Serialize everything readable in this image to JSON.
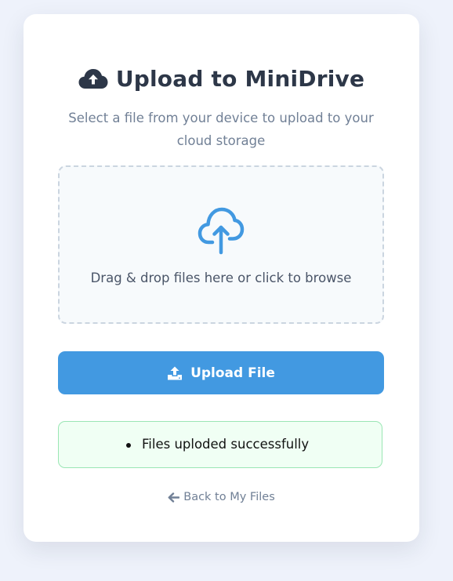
{
  "header": {
    "title": "Upload to MiniDrive",
    "title_icon": "cloud-upload-icon",
    "subtitle": "Select a file from your device to upload to your cloud storage"
  },
  "dropzone": {
    "icon": "cloud-arrow-up-icon",
    "text": "Drag & drop files here or click to browse"
  },
  "upload_button": {
    "icon": "upload-icon",
    "label": "Upload File"
  },
  "alert": {
    "messages": [
      "Files uploded successfully"
    ]
  },
  "back_link": {
    "icon": "arrow-left-icon",
    "label": "Back to My Files"
  },
  "colors": {
    "background": "#eef2fb",
    "card": "#ffffff",
    "title": "#2d3748",
    "muted": "#718096",
    "accent": "#4299e1",
    "success_bg": "#f0fff4",
    "success_border": "#9ae6b4"
  }
}
